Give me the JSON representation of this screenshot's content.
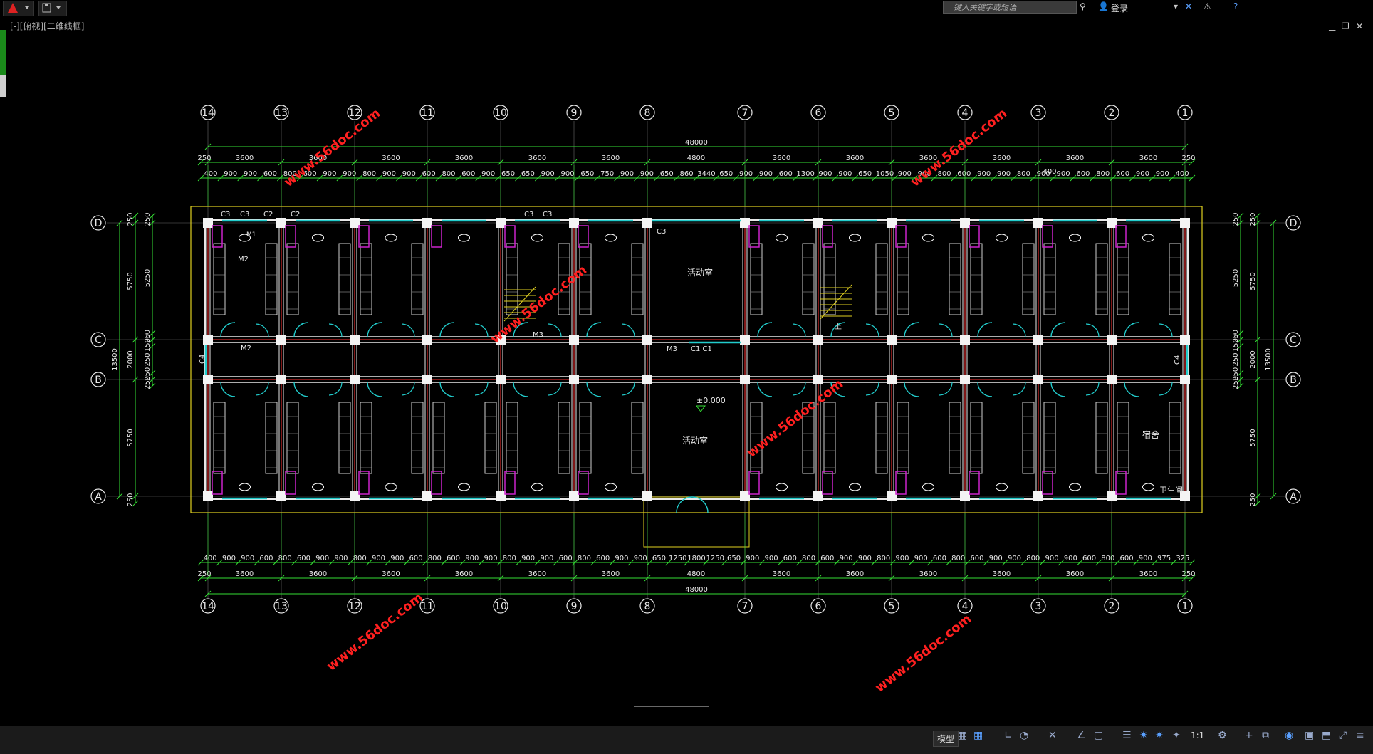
{
  "topbar": {
    "search_placeholder": "键入关键字或短语",
    "login_label": "登录"
  },
  "viewport": {
    "label": "[-][俯视][二维线框]"
  },
  "grid_columns_top": [
    "14",
    "13",
    "12",
    "11",
    "10",
    "9",
    "8",
    "7",
    "6",
    "5",
    "4",
    "3",
    "2",
    "1"
  ],
  "grid_rows": [
    "D",
    "C",
    "B",
    "A"
  ],
  "dims": {
    "overall_top": "48000",
    "overall_bottom": "48000",
    "bay_top": [
      "250",
      "3600",
      "3600",
      "3600",
      "3600",
      "3600",
      "3600",
      "4800",
      "3600",
      "3600",
      "3600",
      "3600",
      "3600",
      "3600",
      "250"
    ],
    "bay_bottom": [
      "250",
      "3600",
      "3600",
      "3600",
      "3600",
      "3600",
      "3600",
      "4800",
      "3600",
      "3600",
      "3600",
      "3600",
      "3600",
      "3600",
      "250"
    ],
    "sub_top": [
      "400",
      "900",
      "900",
      "600",
      "800",
      "600",
      "900",
      "900",
      "800",
      "900",
      "900",
      "600",
      "800",
      "600",
      "900",
      "650",
      "650",
      "900",
      "900",
      "650",
      "750",
      "900",
      "900",
      "650",
      "860",
      "3440",
      "650",
      "900",
      "900",
      "600",
      "1300",
      "900",
      "900",
      "650",
      "1050",
      "900",
      "900",
      "800",
      "600",
      "900",
      "900",
      "800",
      "900",
      "900",
      "600",
      "800",
      "600",
      "900",
      "900",
      "400"
    ],
    "sub_bottom": [
      "400",
      "900",
      "900",
      "600",
      "800",
      "600",
      "900",
      "900",
      "800",
      "900",
      "900",
      "600",
      "800",
      "600",
      "900",
      "900",
      "800",
      "900",
      "900",
      "600",
      "800",
      "600",
      "900",
      "900",
      "650",
      "1250",
      "1800",
      "1250",
      "650",
      "900",
      "900",
      "600",
      "800",
      "600",
      "900",
      "900",
      "800",
      "900",
      "900",
      "600",
      "800",
      "600",
      "900",
      "900",
      "800",
      "900",
      "900",
      "600",
      "800",
      "600",
      "900",
      "975",
      "325"
    ],
    "left_segments": [
      "250",
      "5750",
      "2000",
      "5750",
      "250"
    ],
    "left_inner": [
      "250",
      "5250",
      "250",
      "1500",
      "250",
      "5250",
      "250"
    ],
    "left_total": "13500",
    "right_segments": [
      "250",
      "5750",
      "2000",
      "5750",
      "250"
    ],
    "right_inner": [
      "250",
      "5250",
      "250",
      "1500",
      "250",
      "5250",
      "250"
    ],
    "right_total": "13500",
    "extra_400": "400"
  },
  "labels": {
    "room_activity_top": "活动室",
    "room_activity_bottom": "活动室",
    "dorm": "宿舍",
    "toilet": "卫生间",
    "elevation": "±0.000",
    "stair_up": "上",
    "door_m1": "M1",
    "door_m2": "M2",
    "door_m2b": "M2",
    "door_m3a": "M3",
    "door_m3b": "M3",
    "win_c1": "C1 C1",
    "win_c2a": "C2",
    "win_c2b": "C2",
    "win_c3a": "C3",
    "win_c3b": "C3",
    "win_c3c": "C3",
    "win_c3d": "C3",
    "win_c3e": "C3",
    "win_c4l": "C4",
    "win_c4r": "C4"
  },
  "watermark": "www.56doc.com",
  "status": {
    "model_label": "模型",
    "scale_label": "1:1"
  },
  "colors": {
    "grid_line": "#ff3030",
    "dim": "#33dd33",
    "wall": "#e8e8e8",
    "door": "#22cccc",
    "fixture": "#cc22cc",
    "outline": "#e0d020",
    "watermark": "#ff2020"
  }
}
